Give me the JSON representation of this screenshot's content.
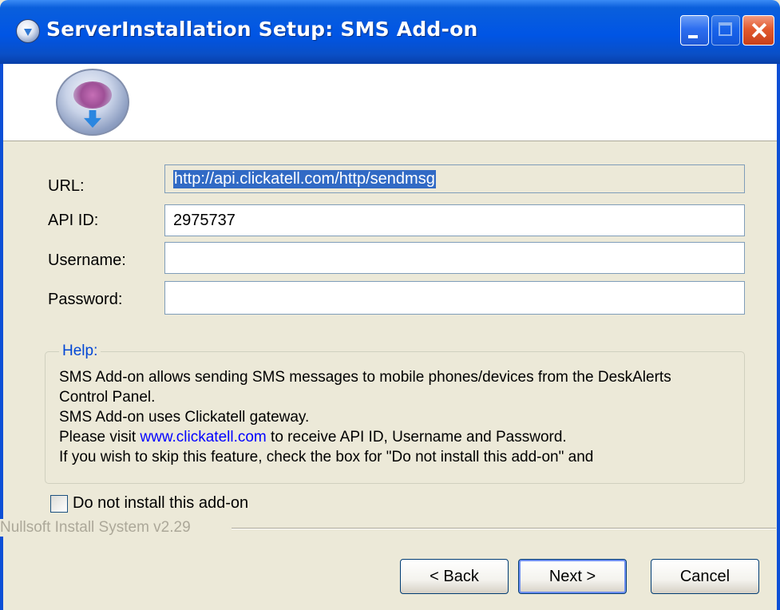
{
  "window": {
    "title": "ServerInstallation Setup: SMS Add-on",
    "icon": "installer-globe-icon",
    "controls": [
      "minimize-icon",
      "maximize-icon",
      "close-icon"
    ]
  },
  "form": {
    "url_label": "URL:",
    "url_value": "http://api.clickatell.com/http/sendmsg",
    "api_id_label": "API ID:",
    "api_id_value": "2975737",
    "username_label": "Username:",
    "username_value": "",
    "password_label": "Password:",
    "password_value": ""
  },
  "help": {
    "title": "Help:",
    "line1": "SMS Add-on allows sending SMS messages to mobile phones/devices from the DeskAlerts",
    "line2": "Control Panel.",
    "line3": "SMS Add-on uses Clickatell gateway.",
    "line4_pre": "Please visit",
    "line4_link": "www.clickatell.com",
    "line4_post": "to receive API ID, Username and Password.",
    "line5": "If you wish to skip this feature, check the box for \"Do not install this add-on\" and"
  },
  "checkbox": {
    "label": "Do not install this add-on",
    "checked": false
  },
  "footer": {
    "branding": "Nullsoft Install System v2.29",
    "back_label": "< Back",
    "next_label": "Next >",
    "cancel_label": "Cancel"
  },
  "colors": {
    "titlebar": "#0055e5",
    "dialog_bg": "#ece9d8",
    "help_title": "#0046d5",
    "link": "#0000ff"
  }
}
